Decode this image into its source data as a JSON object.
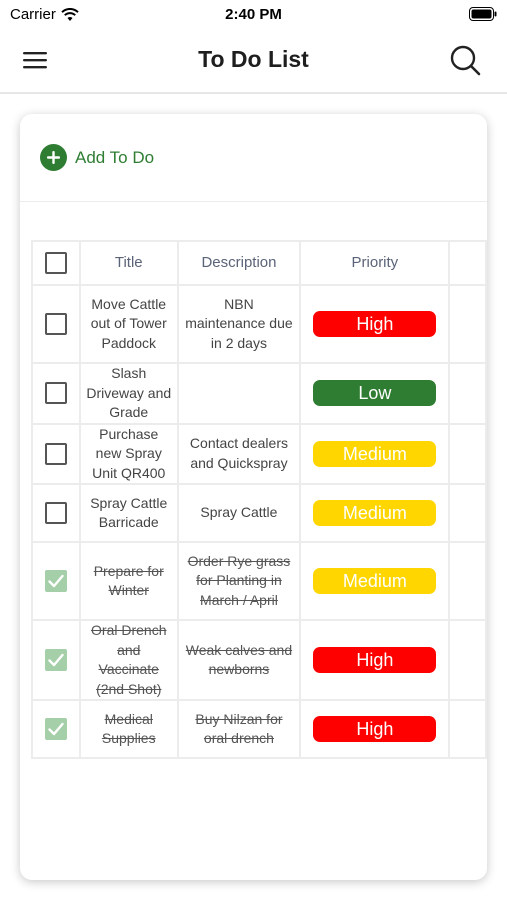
{
  "status_bar": {
    "carrier": "Carrier",
    "time": "2:40 PM"
  },
  "nav": {
    "title": "To Do List",
    "menu_icon": "hamburger-menu-icon",
    "search_icon": "search-icon"
  },
  "add_todo": {
    "label": "Add To Do",
    "icon": "plus-circle-icon"
  },
  "table": {
    "headers": {
      "title": "Title",
      "description": "Description",
      "priority": "Priority"
    },
    "rows": [
      {
        "done": false,
        "title": "Move Cattle out of Tower Paddock",
        "description": "NBN maintenance due in 2 days",
        "priority": "High"
      },
      {
        "done": false,
        "title": "Slash Driveway and Grade",
        "description": "",
        "priority": "Low"
      },
      {
        "done": false,
        "title": "Purchase new Spray Unit QR400",
        "description": "Contact dealers and Quickspray",
        "priority": "Medium"
      },
      {
        "done": false,
        "title": "Spray Cattle Barricade",
        "description": "Spray Cattle",
        "priority": "Medium"
      },
      {
        "done": true,
        "title": "Prepare for Winter",
        "description": "Order Rye grass for Planting in March / April",
        "priority": "Medium"
      },
      {
        "done": true,
        "title": "Oral Drench and Vaccinate (2nd Shot)",
        "description": "Weak calves and newborns",
        "priority": "High"
      },
      {
        "done": true,
        "title": "Medical Supplies",
        "description": "Buy Nilzan for oral drench",
        "priority": "High"
      }
    ]
  },
  "priority_colors": {
    "High": "#ff0000",
    "Low": "#2e7d32",
    "Medium": "#ffd600"
  },
  "accent_color": "#2e7d32"
}
